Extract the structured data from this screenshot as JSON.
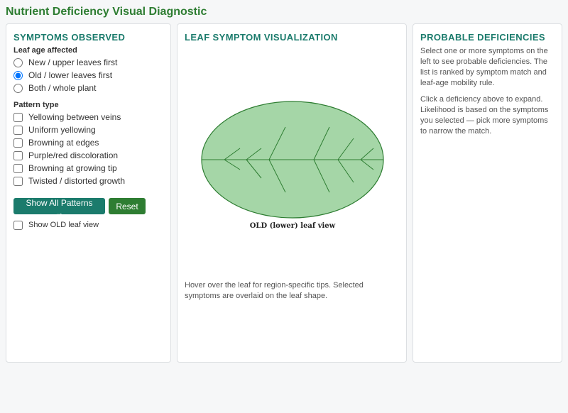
{
  "app": {
    "title": "Nutrient Deficiency Visual Diagnostic"
  },
  "symptoms": {
    "title": "SYMPTOMS OBSERVED",
    "leaf_age_label": "Leaf age affected",
    "leaf_age_options": [
      {
        "label": "New / upper leaves first",
        "selected": false
      },
      {
        "label": "Old / lower leaves first",
        "selected": true
      },
      {
        "label": "Both / whole plant",
        "selected": false
      }
    ],
    "pattern_label": "Pattern type",
    "patterns": [
      {
        "label": "Yellowing between veins",
        "checked": false
      },
      {
        "label": "Uniform yellowing",
        "checked": false
      },
      {
        "label": "Browning at edges",
        "checked": false
      },
      {
        "label": "Purple/red discoloration",
        "checked": false
      },
      {
        "label": "Browning at growing tip",
        "checked": false
      },
      {
        "label": "Twisted / distorted growth",
        "checked": false
      }
    ],
    "show_all_label": "Show All Patterns →",
    "reset_label": "Reset",
    "old_view_label": "Show OLD leaf view",
    "old_view_checked": false
  },
  "visualization": {
    "title": "LEAF SYMPTOM VISUALIZATION",
    "caption": "OLD (lower) leaf view",
    "hint": "Hover over the leaf for region-specific tips. Selected symptoms are overlaid on the leaf shape.",
    "leaf_fill": "#a5d6a7",
    "leaf_stroke": "#2e7d32"
  },
  "deficiencies": {
    "title": "PROBABLE DEFICIENCIES",
    "intro": "Select one or more symptoms on the left to see probable deficiencies. The list is ranked by symptom match and leaf-age mobility rule.",
    "help": "Click a deficiency above to expand. Likelihood is based on the symptoms you selected — pick more symptoms to narrow the match."
  },
  "colors": {
    "accent": "#1b7b6c",
    "brand_green": "#2e7d32"
  }
}
